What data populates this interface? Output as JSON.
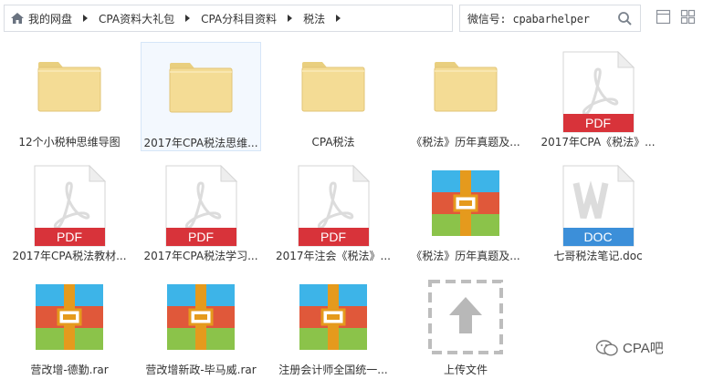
{
  "breadcrumb": {
    "items": [
      "我的网盘",
      "CPA资料大礼包",
      "CPA分科目资料",
      "税法"
    ]
  },
  "search": {
    "value": "微信号: cpabarhelper"
  },
  "files": [
    {
      "label": "12个小税种思维导图",
      "type": "folder"
    },
    {
      "label": "2017年CPA税法思维...",
      "type": "folder",
      "selected": true
    },
    {
      "label": "CPA税法",
      "type": "folder"
    },
    {
      "label": "《税法》历年真题及...",
      "type": "folder"
    },
    {
      "label": "2017年CPA《税法》...",
      "type": "pdf",
      "badge": "PDF"
    },
    {
      "label": "2017年CPA税法教材...",
      "type": "pdf",
      "badge": "PDF"
    },
    {
      "label": "2017年CPA税法学习...",
      "type": "pdf",
      "badge": "PDF"
    },
    {
      "label": "2017年注会《税法》...",
      "type": "pdf",
      "badge": "PDF"
    },
    {
      "label": "《税法》历年真题及...",
      "type": "rar"
    },
    {
      "label": "七哥税法笔记.doc",
      "type": "doc",
      "badge": "DOC"
    },
    {
      "label": "营改增-德勤.rar",
      "type": "rar"
    },
    {
      "label": "营改增新政-毕马威.rar",
      "type": "rar"
    },
    {
      "label": "注册会计师全国统一...",
      "type": "rar"
    },
    {
      "label": "上传文件",
      "type": "upload"
    }
  ],
  "watermark": {
    "text": "CPA吧"
  },
  "colors": {
    "pdf": "#d8333a",
    "doc": "#3c8fd9",
    "folder": "#f4dc95"
  }
}
